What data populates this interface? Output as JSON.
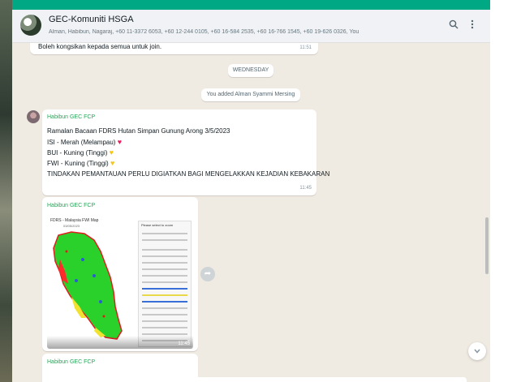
{
  "window": {
    "chat_title": "GEC-Komuniti HSGA",
    "chat_subtitle": "Alman, Habibun, Nagaraj, +60 11-3372 6053, +60 12-244 0105, +60 16-584 2535, +60 16-766 1545, +60 19-626 0326, You"
  },
  "header_icons": [
    "search-icon",
    "menu-icon"
  ],
  "messages": {
    "prev_text": "Boleh kongsikan kepada semua untuk join.",
    "prev_time": "11:51",
    "day_divider": "WEDNESDAY",
    "system_note": "You added Alman Syammi Mersing",
    "msg1": {
      "sender": "Habibun GEC FCP",
      "line1": "Ramalan Bacaan FDRS Hutan Simpan Gunung Arong 3/5/2023",
      "line2": "ISI - Merah (Melampau)",
      "line3": "BUI - Kuning (Tinggi)",
      "line4": "FWI - Kuning (Tinggi)",
      "line5": "TINDAKAN PEMANTAUAN PERLU DIGIATKAN BAGI MENGELAKKAN KEJADIAN KEBAKARAN",
      "time": "11:45"
    },
    "msg2": {
      "sender": "Habibun GEC FCP",
      "image_title": "FDRS - Malaysia FWI Map",
      "image_date": "03/05/2023",
      "panel_title": "Please select to zoom",
      "time": "11:45"
    },
    "msg3": {
      "sender": "Habibun GEC FCP"
    }
  },
  "colors": {
    "accent": "#00a884",
    "sender": "#1fa855",
    "chat_bg": "#efeae2"
  }
}
